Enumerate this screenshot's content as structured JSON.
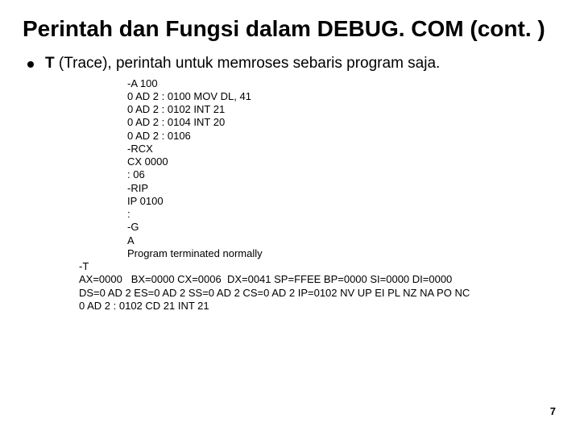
{
  "title": "Perintah dan Fungsi dalam DEBUG. COM  (cont. )",
  "bullet": {
    "cmd": "T",
    "rest": " (Trace), perintah untuk memroses sebaris program saja."
  },
  "code_indent": "-A 100\n0 AD 2 : 0100 MOV DL, 41\n0 AD 2 : 0102 INT 21\n0 AD 2 : 0104 INT 20\n0 AD 2 : 0106\n-RCX\nCX 0000\n: 06\n-RIP\nIP 0100\n:\n-G\nA\nProgram terminated normally",
  "code_wide": "-T\nAX=0000   BX=0000 CX=0006  DX=0041 SP=FFEE BP=0000 SI=0000 DI=0000\nDS=0 AD 2 ES=0 AD 2 SS=0 AD 2 CS=0 AD 2 IP=0102 NV UP EI PL NZ NA PO NC\n0 AD 2 : 0102 CD 21 INT 21",
  "page": "7"
}
